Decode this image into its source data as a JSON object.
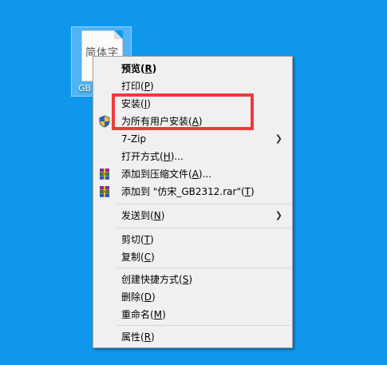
{
  "desktop": {
    "file_icon": {
      "thumb_text": "简体字",
      "label": "GB"
    }
  },
  "context_menu": {
    "items": [
      {
        "label": "预览",
        "key": "R"
      },
      {
        "label": "打印",
        "key": "P"
      },
      {
        "label": "安装",
        "key": "I"
      },
      {
        "label": "为所有用户安装",
        "key": "A",
        "icon": "uac-shield-icon"
      },
      {
        "label": "7-Zip",
        "submenu": true
      },
      {
        "label": "打开方式",
        "key": "H",
        "suffix": "..."
      },
      {
        "label": "添加到压缩文件",
        "key": "A",
        "suffix": "...",
        "icon": "winrar-icon"
      },
      {
        "label": "添加到 \"仿宋_GB2312.rar\"",
        "key": "T",
        "icon": "winrar-icon"
      },
      {
        "label": "发送到",
        "key": "N",
        "submenu": true
      },
      {
        "label": "剪切",
        "key": "T"
      },
      {
        "label": "复制",
        "key": "C"
      },
      {
        "label": "创建快捷方式",
        "key": "S"
      },
      {
        "label": "删除",
        "key": "D"
      },
      {
        "label": "重命名",
        "key": "M"
      },
      {
        "label": "属性",
        "key": "R"
      }
    ]
  },
  "colors": {
    "desktop_background": "#0f97ec",
    "menu_background": "#f0f0f0",
    "highlight_border": "#ef3b3b"
  }
}
